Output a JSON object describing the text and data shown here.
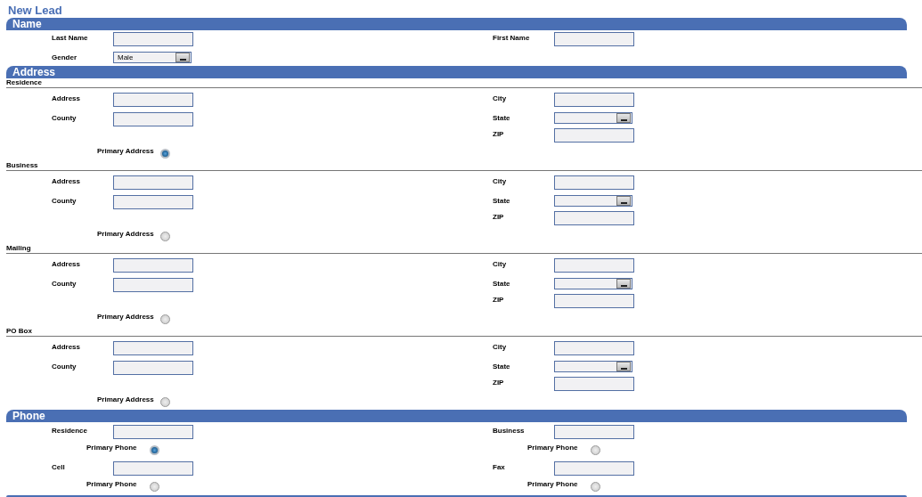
{
  "title": "New Lead",
  "name_section": {
    "title": "Name",
    "left": [
      {
        "kind": "text",
        "label": "Last Name"
      },
      {
        "kind": "select",
        "label": "Gender",
        "value": "Male"
      }
    ],
    "right": [
      {
        "kind": "text",
        "label": "First Name"
      }
    ]
  },
  "address_section": {
    "title": "Address",
    "groups": [
      {
        "title": "Residence",
        "left": [
          {
            "kind": "text",
            "label": "Address"
          },
          {
            "kind": "text",
            "label": "County"
          }
        ],
        "right": [
          {
            "kind": "text",
            "label": "City"
          },
          {
            "kind": "select",
            "label": "State"
          },
          {
            "kind": "text",
            "label": "ZIP"
          }
        ],
        "primary": {
          "label": "Primary Address",
          "selected": true
        }
      },
      {
        "title": "Business",
        "left": [
          {
            "kind": "text",
            "label": "Address"
          },
          {
            "kind": "text",
            "label": "County"
          }
        ],
        "right": [
          {
            "kind": "text",
            "label": "City"
          },
          {
            "kind": "select",
            "label": "State"
          },
          {
            "kind": "text",
            "label": "ZIP"
          }
        ],
        "primary": {
          "label": "Primary Address",
          "selected": false
        }
      },
      {
        "title": "Mailing",
        "left": [
          {
            "kind": "text",
            "label": "Address"
          },
          {
            "kind": "text",
            "label": "County"
          }
        ],
        "right": [
          {
            "kind": "text",
            "label": "City"
          },
          {
            "kind": "select",
            "label": "State"
          },
          {
            "kind": "text",
            "label": "ZIP"
          }
        ],
        "primary": {
          "label": "Primary Address",
          "selected": false
        }
      },
      {
        "title": "PO Box",
        "left": [
          {
            "kind": "text",
            "label": "Address"
          },
          {
            "kind": "text",
            "label": "County"
          }
        ],
        "right": [
          {
            "kind": "text",
            "label": "City"
          },
          {
            "kind": "select",
            "label": "State"
          },
          {
            "kind": "text",
            "label": "ZIP"
          }
        ],
        "primary": {
          "label": "Primary Address",
          "selected": false
        }
      }
    ]
  },
  "phone_section": {
    "title": "Phone",
    "phones": [
      {
        "label": "Residence",
        "primary": {
          "label": "Primary Phone",
          "selected": true
        }
      },
      {
        "label": "Business",
        "primary": {
          "label": "Primary Phone",
          "selected": false
        }
      },
      {
        "label": "Cell",
        "primary": {
          "label": "Primary Phone",
          "selected": false
        }
      },
      {
        "label": "Fax",
        "primary": {
          "label": "Primary Phone",
          "selected": false
        }
      }
    ]
  }
}
